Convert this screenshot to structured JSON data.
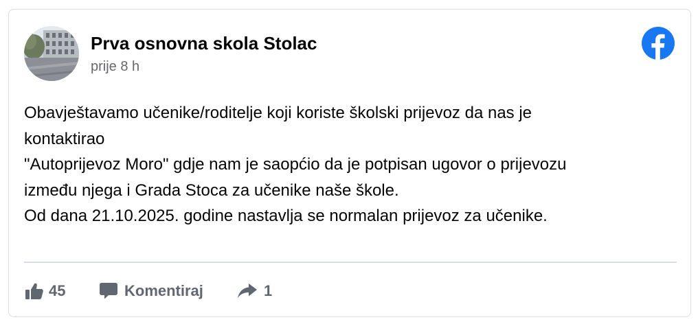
{
  "post": {
    "page_name": "Prva osnovna skola Stolac",
    "timestamp": "prije 8 h",
    "text_lines": [
      "Obavještavamo učenike/roditelje koji koriste školski prijevoz da nas je",
      "kontaktirao",
      "\"Autoprijevoz Moro\" gdje nam je saopćio da je potpisan ugovor o prijevozu",
      "između njega i Grada Stoca za učenike naše škole.",
      "Od dana 21.10.2025. godine nastavlja se normalan prijevoz za učenike."
    ]
  },
  "actions": {
    "like_icon": "thumbs-up-icon",
    "like_count": "45",
    "comment_icon": "speech-bubble-icon",
    "comment_label": "Komentiraj",
    "share_icon": "share-arrow-icon",
    "share_count": "1"
  },
  "icons": {
    "brand": "facebook-logo-icon"
  },
  "colors": {
    "facebook_blue": "#1877f2",
    "action_gray": "#606770",
    "timestamp_gray": "#65676b",
    "border": "#dadde1"
  }
}
